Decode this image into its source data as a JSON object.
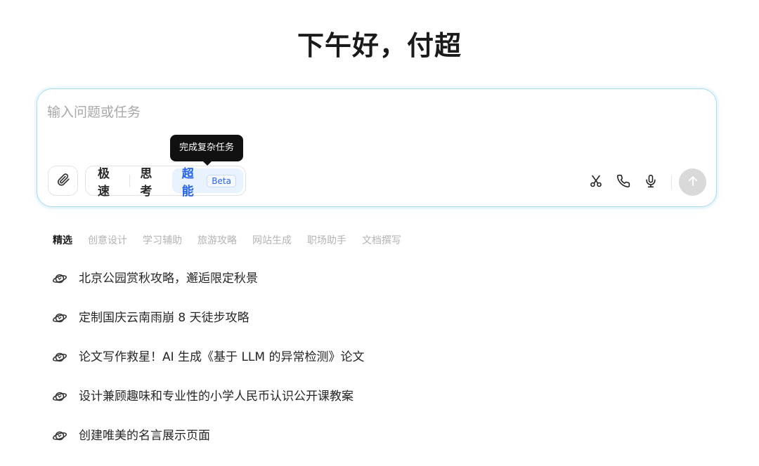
{
  "greeting": "下午好，付超",
  "composer": {
    "placeholder": "输入问题或任务",
    "tooltip": "完成复杂任务",
    "icons": {
      "attach": "paperclip-icon",
      "scissors": "scissors-icon",
      "phone": "phone-icon",
      "microphone": "microphone-icon",
      "send": "arrow-up-icon"
    },
    "modes": [
      {
        "label": "极速",
        "active": false
      },
      {
        "label": "思考",
        "active": false
      },
      {
        "label": "超能",
        "active": true,
        "badge": "Beta"
      }
    ]
  },
  "tabs": [
    {
      "label": "精选",
      "active": true
    },
    {
      "label": "创意设计"
    },
    {
      "label": "学习辅助"
    },
    {
      "label": "旅游攻略"
    },
    {
      "label": "网站生成"
    },
    {
      "label": "职场助手"
    },
    {
      "label": "文档撰写"
    }
  ],
  "suggestions": [
    {
      "icon": "planet-icon",
      "text": "北京公园赏秋攻略，邂逅限定秋景"
    },
    {
      "icon": "planet-icon",
      "text": "定制国庆云南雨崩 8 天徒步攻略"
    },
    {
      "icon": "planet-icon",
      "text": "论文写作救星！AI 生成《基于 LLM 的异常检测》论文"
    },
    {
      "icon": "planet-icon",
      "text": "设计兼顾趣味和专业性的小学人民币认识公开课教案"
    },
    {
      "icon": "planet-icon",
      "text": "创建唯美的名言展示页面"
    }
  ],
  "colors": {
    "accent": "#2563eb",
    "composer_border": "#a9dcf5",
    "active_mode_bg": "#e9f3ff"
  }
}
